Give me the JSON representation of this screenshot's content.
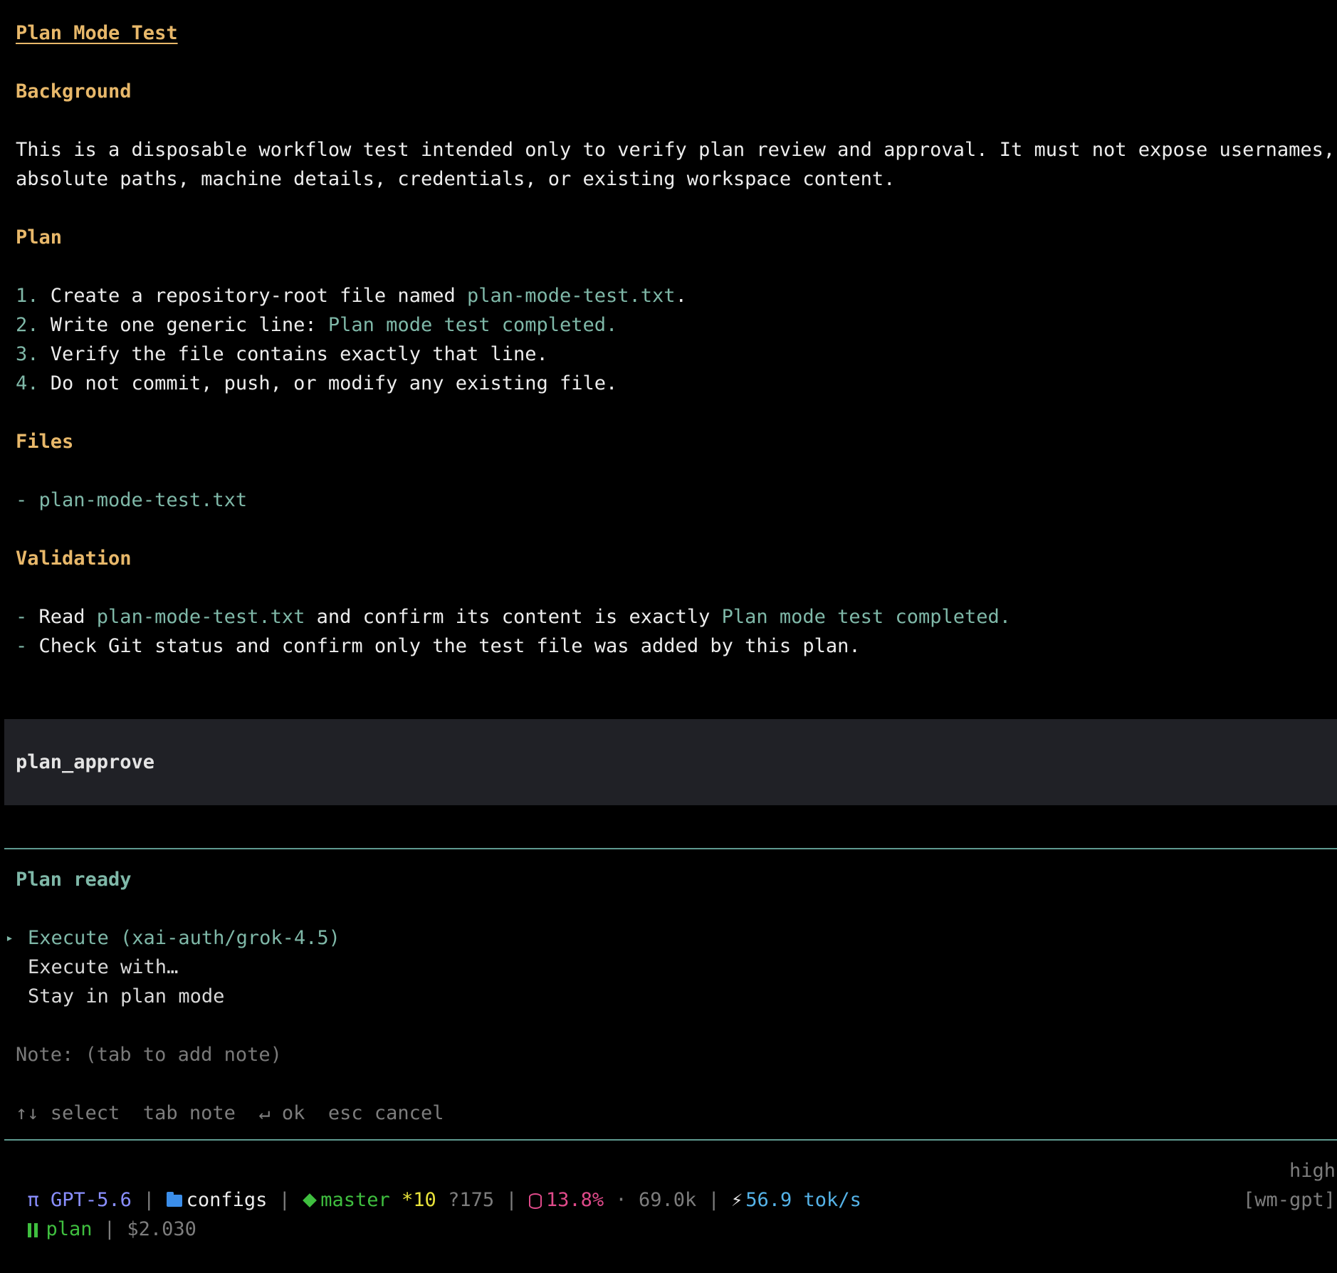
{
  "document": {
    "title": "Plan Mode Test",
    "background_heading": "Background",
    "background_line1": "This is a disposable workflow test intended only to verify plan review and approval. It must not expose usernames,",
    "background_line2": "absolute paths, machine details, credentials, or existing workspace content.",
    "plan_heading": "Plan",
    "plan_steps": [
      {
        "num": "1.",
        "pre": " Create a repository-root file named ",
        "code": "plan-mode-test.txt",
        "post": "."
      },
      {
        "num": "2.",
        "pre": " Write one generic line: ",
        "code": "Plan mode test completed.",
        "post": ""
      },
      {
        "num": "3.",
        "pre": " Verify the file contains exactly that line.",
        "code": "",
        "post": ""
      },
      {
        "num": "4.",
        "pre": " Do not commit, push, or modify any existing file.",
        "code": "",
        "post": ""
      }
    ],
    "files_heading": "Files",
    "files_item_dash": "- ",
    "files_item": "plan-mode-test.txt",
    "validation_heading": "Validation",
    "validation_1_dash": "- ",
    "validation_1_pre": "Read ",
    "validation_1_code": "plan-mode-test.txt",
    "validation_1_mid": " and confirm its content is exactly ",
    "validation_1_code2": "Plan mode test completed.",
    "validation_2_dash": "- ",
    "validation_2_text": "Check Git status and confirm only the test file was added by this plan."
  },
  "tool": {
    "name": "plan_approve"
  },
  "prompt": {
    "title": "Plan ready",
    "marker": "▸",
    "options": [
      "Execute (xai-auth/grok-4.5)",
      "Execute with…",
      "Stay in plan mode"
    ],
    "note": "Note: (tab to add note)",
    "hints": "↑↓ select  tab note  ↵ ok  esc cancel"
  },
  "status": {
    "pi": "π",
    "model": "GPT-5.6",
    "sep": " | ",
    "folder": "configs",
    "branch": "master",
    "modified": "*10",
    "untracked": "?175",
    "context_pct": "13.8%",
    "dot": " · ",
    "context_tokens": "69.0k",
    "speed": "56.9 tok/s",
    "effort": "high",
    "mode": "plan",
    "cost": "$2.030",
    "session": "[wm-gpt]"
  },
  "colors": {
    "heading": "#e8b86a",
    "accent_teal": "#7fb8a8",
    "background": "#000000",
    "tool_box": "#202126"
  }
}
